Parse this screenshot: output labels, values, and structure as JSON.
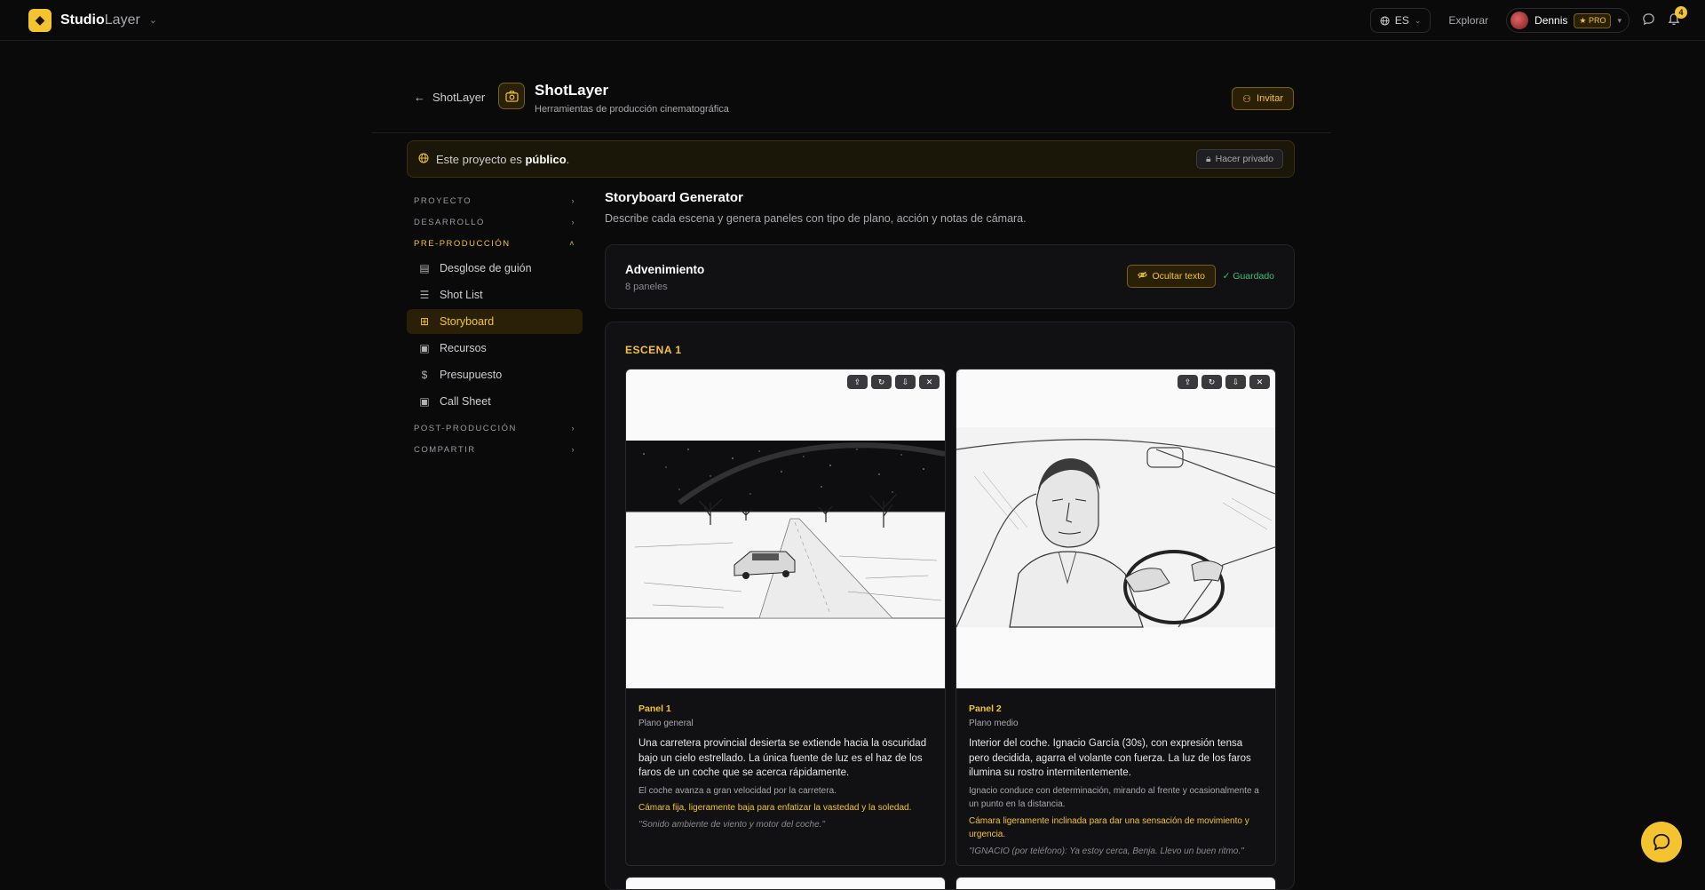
{
  "app": {
    "brand_bold": "Studio",
    "brand_light": "Layer",
    "lang": "ES",
    "explore": "Explorar",
    "user_name": "Dennis",
    "pro_badge": "★ PRO",
    "notif_count": "4"
  },
  "header": {
    "back_label": "ShotLayer",
    "title": "ShotLayer",
    "subtitle": "Herramientas de producción cinematográfica",
    "invite_label": "Invitar"
  },
  "visibility": {
    "prefix": "Este proyecto es ",
    "state": "público",
    "suffix": ".",
    "action": "Hacer privado"
  },
  "sidebar": {
    "sections": [
      {
        "label": "PROYECTO"
      },
      {
        "label": "DESARROLLO"
      },
      {
        "label": "PRE-PRODUCCIÓN"
      },
      {
        "label": "POST-PRODUCCIÓN"
      },
      {
        "label": "COMPARTIR"
      }
    ],
    "items": [
      {
        "label": "Desglose de guión",
        "icon": "document-icon"
      },
      {
        "label": "Shot List",
        "icon": "list-icon"
      },
      {
        "label": "Storyboard",
        "icon": "grid-icon"
      },
      {
        "label": "Recursos",
        "icon": "clipboard-icon"
      },
      {
        "label": "Presupuesto",
        "icon": "dollar-icon"
      },
      {
        "label": "Call Sheet",
        "icon": "clipboard-icon"
      }
    ]
  },
  "main": {
    "title": "Storyboard Generator",
    "subtitle": "Describe cada escena y genera paneles con tipo de plano, acción y notas de cámara.",
    "storyboard": {
      "name": "Advenimiento",
      "count": "8 paneles",
      "hide_text": "Ocultar texto",
      "saved": "✓ Guardado"
    },
    "scene": {
      "label": "ESCENA 1",
      "panels": [
        {
          "name": "Panel 1",
          "shot": "Plano general",
          "description": "Una carretera provincial desierta se extiende hacia la oscuridad bajo un cielo estrellado. La única fuente de luz es el haz de los faros de un coche que se acerca rápidamente.",
          "action": "El coche avanza a gran velocidad por la carretera.",
          "camera": "Cámara fija, ligeramente baja para enfatizar la vastedad y la soledad.",
          "audio": "\"Sonido ambiente de viento y motor del coche.\""
        },
        {
          "name": "Panel 2",
          "shot": "Plano medio",
          "description": "Interior del coche. Ignacio García (30s), con expresión tensa pero decidida, agarra el volante con fuerza. La luz de los faros ilumina su rostro intermitentemente.",
          "action": "Ignacio conduce con determinación, mirando al frente y ocasionalmente a un punto en la distancia.",
          "camera": "Cámara ligeramente inclinada para dar una sensación de movimiento y urgencia.",
          "audio": "\"IGNACIO (por teléfono): Ya estoy cerca, Benja. Llevo un buen ritmo.\""
        }
      ]
    }
  },
  "colors": {
    "accent": "#f4c430",
    "background": "#0a0a0b",
    "success": "#34c37a"
  }
}
